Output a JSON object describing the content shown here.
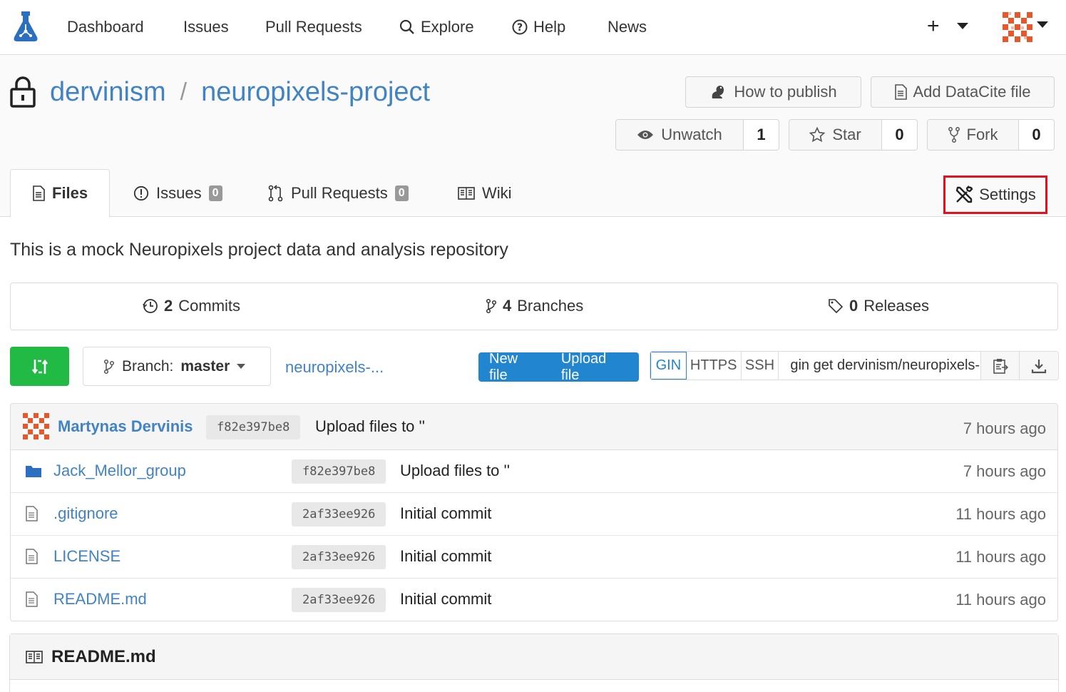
{
  "nav": {
    "items": [
      "Dashboard",
      "Issues",
      "Pull Requests",
      "Explore",
      "Help",
      "News"
    ],
    "plus": "+"
  },
  "repo": {
    "owner": "dervinism",
    "separator": "/",
    "name": "neuropixels-project",
    "how_to_publish": "How to publish",
    "add_datacite": "Add DataCite file",
    "unwatch_label": "Unwatch",
    "watch_count": "1",
    "star_label": "Star",
    "star_count": "0",
    "fork_label": "Fork",
    "fork_count": "0"
  },
  "tabs": {
    "files": "Files",
    "issues": "Issues",
    "issues_count": "0",
    "pulls": "Pull Requests",
    "pulls_count": "0",
    "wiki": "Wiki",
    "settings": "Settings"
  },
  "description": "This is a mock Neuropixels project data and analysis repository",
  "stats": {
    "commits_count": "2",
    "commits_label": "Commits",
    "branches_count": "4",
    "branches_label": "Branches",
    "releases_count": "0",
    "releases_label": "Releases"
  },
  "toolbar": {
    "branch_prefix": "Branch:",
    "branch_name": "master",
    "path_link": "neuropixels-...",
    "new_file": "New file",
    "upload_file": "Upload file",
    "protocols": [
      "GIN",
      "HTTPS",
      "SSH"
    ],
    "clone_url": "gin get dervinism/neuropixels-project"
  },
  "latest_commit": {
    "author": "Martynas Dervinis",
    "sha": "f82e397be8",
    "message": "Upload files to ''",
    "age": "7 hours ago"
  },
  "files": [
    {
      "name": "Jack_Mellor_group",
      "type": "folder",
      "sha": "f82e397be8",
      "message": "Upload files to ''",
      "age": "7 hours ago"
    },
    {
      "name": ".gitignore",
      "type": "file",
      "sha": "2af33ee926",
      "message": "Initial commit",
      "age": "11 hours ago"
    },
    {
      "name": "LICENSE",
      "type": "file",
      "sha": "2af33ee926",
      "message": "Initial commit",
      "age": "11 hours ago"
    },
    {
      "name": "README.md",
      "type": "file",
      "sha": "2af33ee926",
      "message": "Initial commit",
      "age": "11 hours ago"
    }
  ],
  "readme": {
    "title": "README.md"
  },
  "colors": {
    "accent": "#4183c4",
    "primary": "#2185d0",
    "green": "#21ba45",
    "highlight": "#e0121d"
  }
}
